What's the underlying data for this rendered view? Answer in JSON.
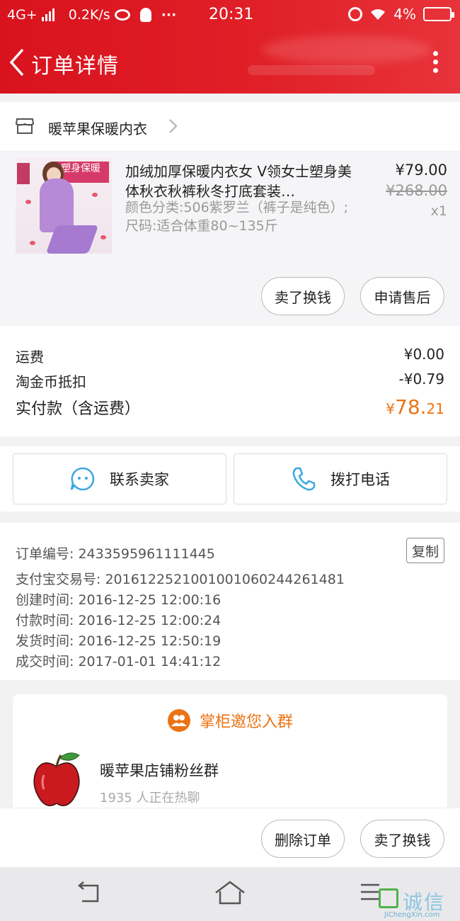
{
  "status_bar": {
    "network": "4G+",
    "speed": "0.2K/s",
    "dots": "···",
    "time": "20:31",
    "battery": "4%"
  },
  "header": {
    "title": "订单详情"
  },
  "shop": {
    "name": "暖苹果保暖内衣"
  },
  "product": {
    "title": "加绒加厚保暖内衣女 V领女士塑身美体秋衣秋裤秋冬打底套装…",
    "spec": "颜色分类:506紫罗兰（裤子是纯色）;尺码:适合体重80~135斤",
    "price": "¥79.00",
    "original_price": "¥268.00",
    "quantity": "x1",
    "image_badge": "塑身保暖",
    "actions": {
      "resell": "卖了换钱",
      "after_sale": "申请售后"
    }
  },
  "fees": {
    "shipping_label": "运费",
    "shipping_value": "¥0.00",
    "coin_label": "淘金币抵扣",
    "coin_value": "-¥0.79",
    "total_label": "实付款（含运费）",
    "total_currency": "¥",
    "total_int": "78.",
    "total_dec": "21"
  },
  "contact": {
    "seller": "联系卖家",
    "phone": "拨打电话"
  },
  "order_info": {
    "order_no": "订单编号: 2433595961111445",
    "copy": "复制",
    "alipay_no": "支付宝交易号: 2016122521001001060244261481",
    "created": "创建时间: 2016-12-25 12:00:16",
    "paid": "付款时间: 2016-12-25 12:00:24",
    "shipped": "发货时间: 2016-12-25 12:50:19",
    "completed": "成交时间: 2017-01-01 14:41:12"
  },
  "group": {
    "heading": "掌柜邀您入群",
    "name": "暖苹果店铺粉丝群",
    "count": "1935 人正在热聊"
  },
  "bottom_actions": {
    "delete": "删除订单",
    "resell": "卖了换钱"
  },
  "watermark": {
    "text": "诚信",
    "sub": "JiChengXin.com"
  },
  "colors": {
    "header_red": "#e01f27",
    "accent_orange": "#ec7314"
  }
}
